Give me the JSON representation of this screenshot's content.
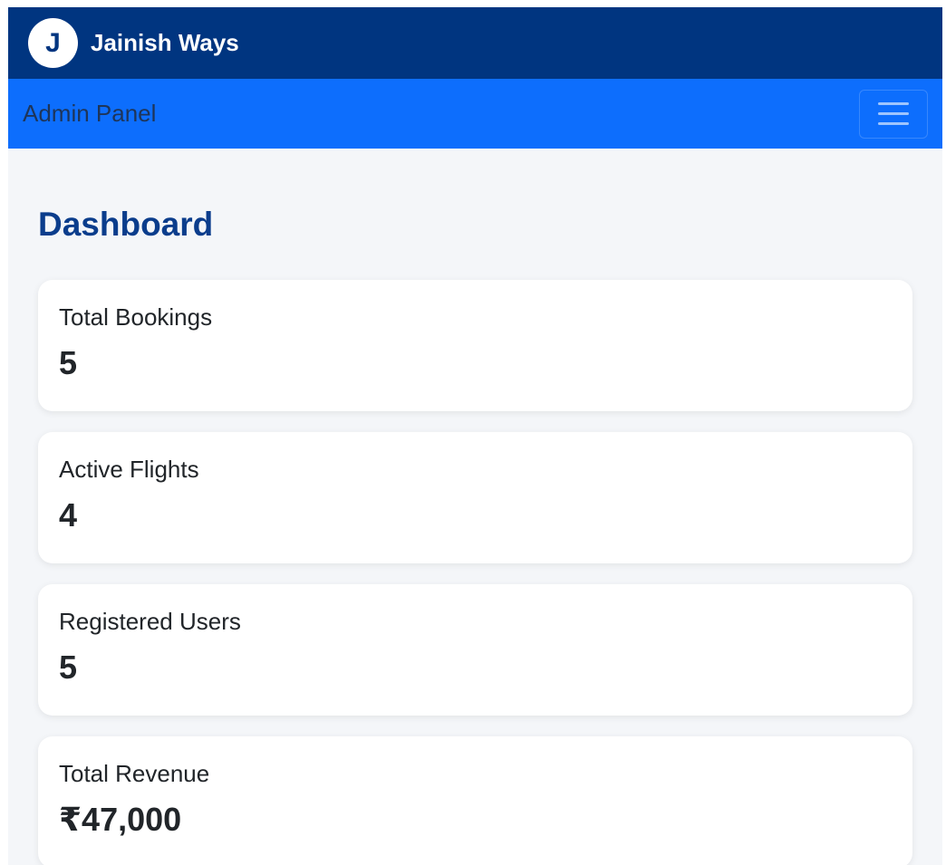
{
  "header": {
    "logo_letter": "J",
    "brand": "Jainish Ways"
  },
  "admin_bar": {
    "title": "Admin Panel"
  },
  "main": {
    "title": "Dashboard",
    "cards": [
      {
        "label": "Total Bookings",
        "value": "5"
      },
      {
        "label": "Active Flights",
        "value": "4"
      },
      {
        "label": "Registered Users",
        "value": "5"
      },
      {
        "label": "Total Revenue",
        "value": "₹47,000"
      }
    ]
  },
  "colors": {
    "topbar": "#003580",
    "adminbar": "#0d6efd",
    "title": "#0b3d8c",
    "background": "#f4f6f9"
  },
  "icons": {
    "menu": "hamburger-menu-icon"
  }
}
